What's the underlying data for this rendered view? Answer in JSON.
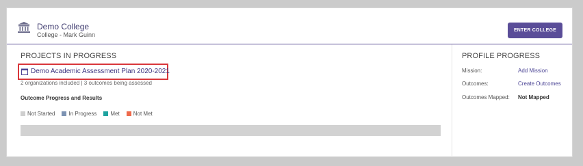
{
  "college": {
    "name": "Demo College",
    "subtitle": "College - Mark Guinn",
    "enter_label": "ENTER COLLEGE"
  },
  "projects": {
    "title": "PROJECTS IN PROGRESS",
    "project_name": "Demo Academic Assessment Plan 2020-2021",
    "meta": "2 organizations included | 3 outcomes being assessed",
    "outcome_title": "Outcome Progress and Results",
    "legend": [
      {
        "label": "Not Started",
        "color": "#cfcfcf"
      },
      {
        "label": "In Progress",
        "color": "#7d93b3"
      },
      {
        "label": "Met",
        "color": "#1fa3a0"
      },
      {
        "label": "Not Met",
        "color": "#ee6a4b"
      }
    ],
    "progress": {
      "not_started": 1.0,
      "in_progress": 0,
      "met": 0,
      "not_met": 0
    }
  },
  "profile": {
    "title": "PROFILE PROGRESS",
    "rows": [
      {
        "label": "Mission:",
        "value": "Add Mission"
      },
      {
        "label": "Outcomes:",
        "value": "Create Outcomes"
      },
      {
        "label": "Outcomes Mapped:",
        "value": "Not Mapped"
      }
    ]
  },
  "colors": {
    "accent": "#5a4d98",
    "highlight": "#d9363a"
  }
}
